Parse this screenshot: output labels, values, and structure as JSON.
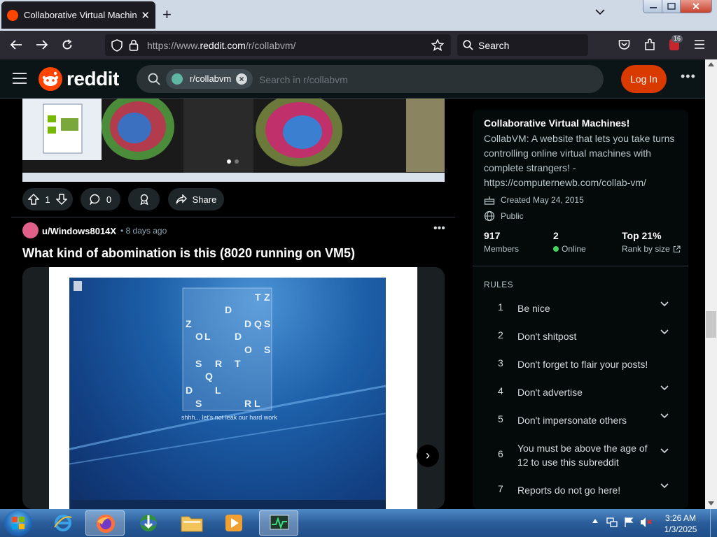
{
  "browser": {
    "tab_title": "Collaborative Virtual Machines!",
    "tab_close": "✕",
    "new_tab": "+",
    "url_prefix": "https://www.",
    "url_domain": "reddit.com",
    "url_path": "/r/collabvm/",
    "search_placeholder": "Search",
    "extension_badge": "16"
  },
  "reddit_header": {
    "logo_text": "reddit",
    "community_chip": "r/collabvm",
    "search_placeholder": "Search in r/collabvm",
    "login_label": "Log In",
    "more": "•••"
  },
  "post1": {
    "votes": "1",
    "comments": "0",
    "share_label": "Share"
  },
  "post2": {
    "username": "u/Windows8014X",
    "time": "• 8 days ago",
    "more": "•••",
    "title": "What kind of abomination is this (8020 running on VM5)",
    "screen_caption": "shhh... let's not leak our hard work",
    "screen_letters": [
      "T",
      "Z",
      "D",
      "Z",
      "D",
      "Q",
      "S",
      "O",
      "L",
      "D",
      "O",
      "S",
      "S",
      "R",
      "T",
      "Q",
      "D",
      "L",
      "S",
      "R",
      "L"
    ],
    "next_label": "›"
  },
  "sidebar": {
    "title": "Collaborative Virtual Machines!",
    "description": "CollabVM: A website that lets you take turns controlling online virtual machines with complete strangers! - https://computernewb.com/collab-vm/",
    "created": "Created May 24, 2015",
    "visibility": "Public",
    "members_value": "917",
    "members_label": "Members",
    "online_value": "2",
    "online_label": "Online",
    "rank_value": "Top 21%",
    "rank_label": "Rank by size",
    "rules_heading": "RULES",
    "rules": [
      {
        "num": "1",
        "text": "Be nice"
      },
      {
        "num": "2",
        "text": "Don't shitpost"
      },
      {
        "num": "3",
        "text": "Don't forget to flair your posts!"
      },
      {
        "num": "4",
        "text": "Don't advertise"
      },
      {
        "num": "5",
        "text": "Don't impersonate others"
      },
      {
        "num": "6",
        "text": "You must be above the age of 12 to use this subreddit"
      },
      {
        "num": "7",
        "text": "Reports do not go here!"
      }
    ]
  },
  "taskbar": {
    "time": "3:26 AM",
    "date": "1/3/2025"
  },
  "colors": {
    "reddit_orange": "#ff4500",
    "login_button": "#d93a00",
    "online_dot": "#46d160",
    "reddit_bg": "#0b1416"
  }
}
